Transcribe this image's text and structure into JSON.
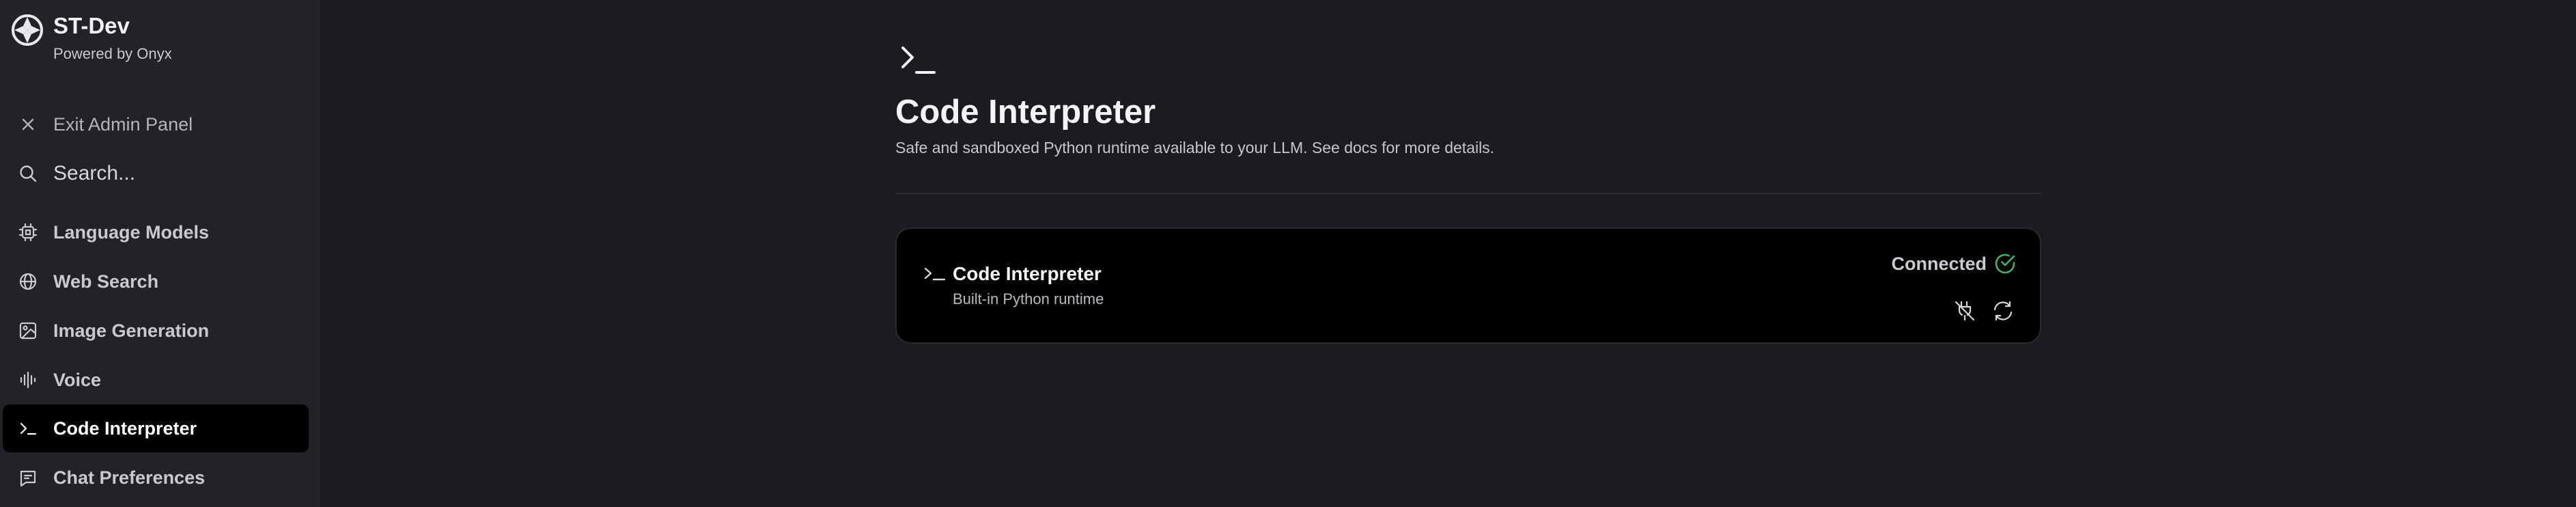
{
  "brand": {
    "name": "ST-Dev",
    "subtitle": "Powered by Onyx"
  },
  "sidebar": {
    "exit_label": "Exit Admin Panel",
    "search_placeholder": "Search...",
    "items": [
      {
        "label": "Language Models",
        "icon": "cpu-icon"
      },
      {
        "label": "Web Search",
        "icon": "globe-icon"
      },
      {
        "label": "Image Generation",
        "icon": "image-icon"
      },
      {
        "label": "Voice",
        "icon": "audio-wave-icon"
      },
      {
        "label": "Code Interpreter",
        "icon": "terminal-icon",
        "active": true
      },
      {
        "label": "Chat Preferences",
        "icon": "chat-icon"
      }
    ]
  },
  "main": {
    "title": "Code Interpreter",
    "description": "Safe and sandboxed Python runtime available to your LLM. See docs for more details."
  },
  "card": {
    "title": "Code Interpreter",
    "subtitle": "Built-in Python runtime",
    "status": "Connected"
  },
  "colors": {
    "background": "#1c1c20",
    "sidebar": "#232327",
    "active_item": "#000000",
    "card": "#000000",
    "connected": "#3fb463"
  }
}
